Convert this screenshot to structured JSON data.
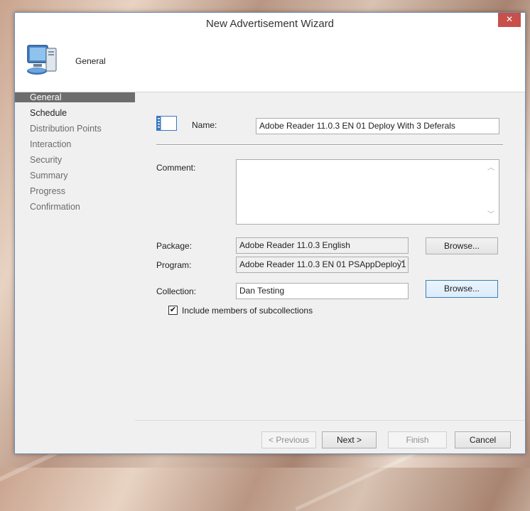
{
  "window": {
    "title": "New Advertisement Wizard",
    "close_glyph": "✕"
  },
  "header": {
    "title": "General",
    "icon": "computer-icon"
  },
  "sidebar": {
    "items": [
      {
        "label": "General",
        "state": "active"
      },
      {
        "label": "Schedule",
        "state": "bold"
      },
      {
        "label": "Distribution Points",
        "state": "normal"
      },
      {
        "label": "Interaction",
        "state": "normal"
      },
      {
        "label": "Security",
        "state": "normal"
      },
      {
        "label": "Summary",
        "state": "normal"
      },
      {
        "label": "Progress",
        "state": "normal"
      },
      {
        "label": "Confirmation",
        "state": "normal"
      }
    ]
  },
  "form": {
    "name_label": "Name:",
    "name_value": "Adobe Reader 11.0.3 EN 01 Deploy With 3 Deferals",
    "comment_label": "Comment:",
    "comment_value": "",
    "package_label": "Package:",
    "package_value": "Adobe Reader 11.0.3 English",
    "program_label": "Program:",
    "program_value": "Adobe Reader 11.0.3 EN 01 PSAppDeploy1",
    "collection_label": "Collection:",
    "collection_value": "Dan Testing",
    "browse_label": "Browse...",
    "include_subcollections_label": "Include members of subcollections",
    "include_subcollections_checked": true
  },
  "footer": {
    "previous_label": "< Previous",
    "next_label": "Next >",
    "finish_label": "Finish",
    "cancel_label": "Cancel"
  }
}
